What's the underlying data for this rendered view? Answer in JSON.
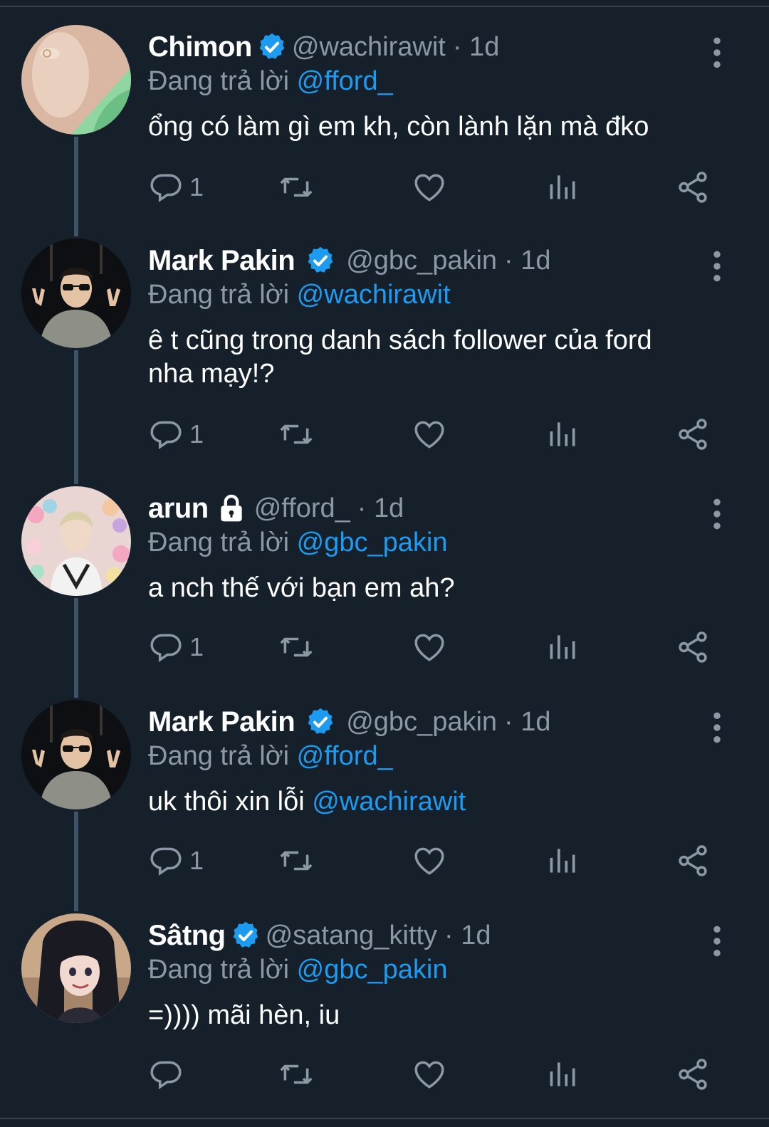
{
  "reply_prefix": "Đang trả lời",
  "tweets": [
    {
      "name": "Chimon",
      "verified": true,
      "locked": false,
      "handle": "@wachirawit",
      "time": "· 1d",
      "reply_to": "@fford_",
      "text_lines": [
        "ổng có làm gì em kh, còn lành lặn mà đko"
      ],
      "text_mention": "",
      "reply_count": "1",
      "avatar": "avatar-hand-green-shirt"
    },
    {
      "name": "Mark Pakin",
      "verified": true,
      "locked": false,
      "handle": "@gbc_pakin",
      "time": "· 1d",
      "reply_to": "@wachirawit",
      "text_lines": [
        "ê t cũng trong danh sách follower của ford",
        "nha mạy!?"
      ],
      "text_mention": "",
      "reply_count": "1",
      "avatar": "avatar-man-sunglasses-peace"
    },
    {
      "name": "arun",
      "verified": false,
      "locked": true,
      "handle": "@fford_",
      "time": "· 1d",
      "reply_to": "@gbc_pakin",
      "text_lines": [
        "a nch thế với bạn em ah?"
      ],
      "text_mention": "",
      "reply_count": "1",
      "avatar": "avatar-man-plush-toys"
    },
    {
      "name": "Mark Pakin",
      "verified": true,
      "locked": false,
      "handle": "@gbc_pakin",
      "time": "· 1d",
      "reply_to": "@fford_",
      "text_lines": [
        "uk thôi xin lỗi "
      ],
      "text_mention": "@wachirawit",
      "reply_count": "1",
      "avatar": "avatar-man-sunglasses-peace"
    },
    {
      "name": "Sâtng",
      "verified": true,
      "locked": false,
      "handle": "@satang_kitty",
      "time": "· 1d",
      "reply_to": "@gbc_pakin",
      "text_lines": [
        "=)))) mãi hèn, iu"
      ],
      "text_mention": "",
      "reply_count": "",
      "avatar": "avatar-cartoon-vampire-girl"
    }
  ],
  "colors": {
    "background": "#15202b",
    "accent": "#1d9bf0",
    "muted": "#8b98a5",
    "thread_line": "#3d5466"
  },
  "icons": [
    "reply-icon",
    "retweet-icon",
    "like-icon",
    "views-icon",
    "share-icon",
    "more-icon",
    "verified-badge-icon",
    "lock-icon"
  ]
}
